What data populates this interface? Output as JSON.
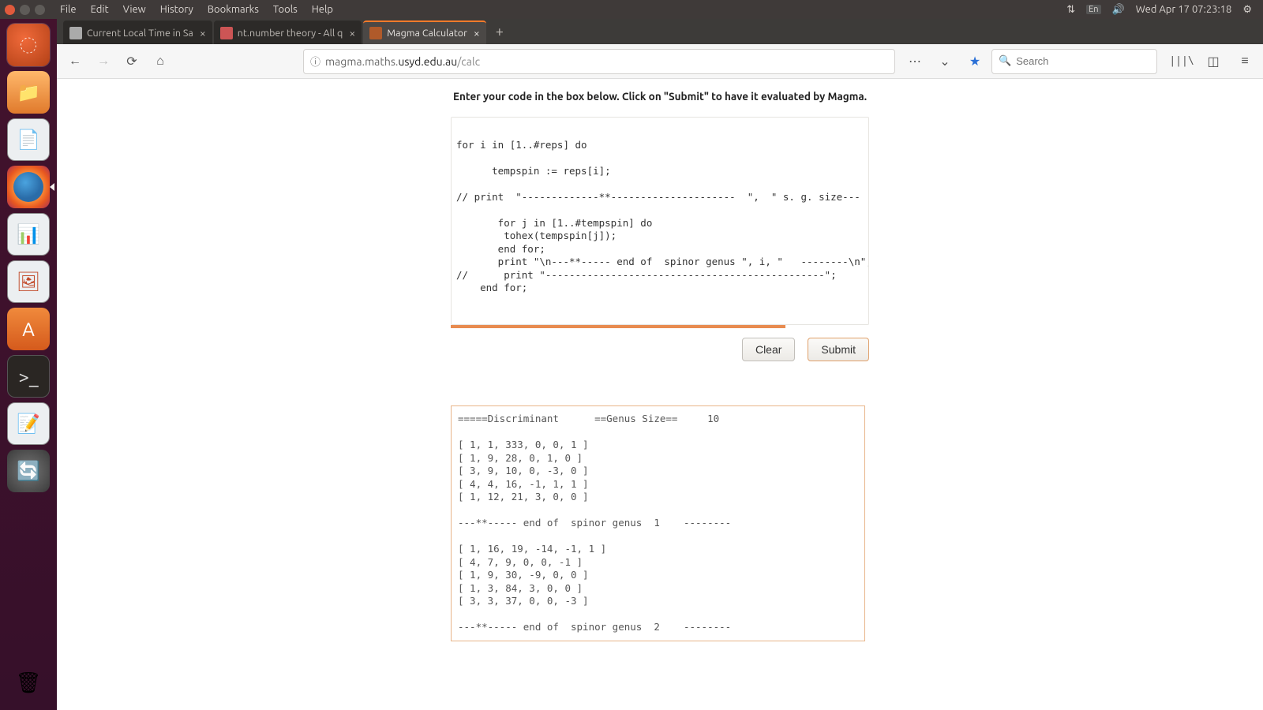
{
  "menubar": {
    "items": [
      "File",
      "Edit",
      "View",
      "History",
      "Bookmarks",
      "Tools",
      "Help"
    ],
    "tray": {
      "lang": "En",
      "datetime": "Wed Apr 17 07:23:18"
    }
  },
  "launcher": {
    "items": [
      {
        "name": "dash",
        "label": "Dash"
      },
      {
        "name": "files",
        "label": "Files"
      },
      {
        "name": "writer",
        "label": "Writer"
      },
      {
        "name": "firefox",
        "label": "Firefox",
        "active": true
      },
      {
        "name": "calc",
        "label": "Calc"
      },
      {
        "name": "impress",
        "label": "Impress"
      },
      {
        "name": "store",
        "label": "Software"
      },
      {
        "name": "terminal",
        "label": "Terminal"
      },
      {
        "name": "textedit",
        "label": "Text Editor"
      },
      {
        "name": "updater",
        "label": "Updater"
      }
    ],
    "trash_label": "Trash"
  },
  "browser": {
    "tabs": [
      {
        "title": "Current Local Time in Sa",
        "active": false
      },
      {
        "title": "nt.number theory - All q",
        "active": false
      },
      {
        "title": "Magma Calculator",
        "active": true
      }
    ],
    "address": {
      "prefix": "magma.maths.",
      "host": "usyd.edu.au",
      "path": "/calc"
    },
    "search_placeholder": "Search"
  },
  "page": {
    "instruction": "Enter your code in the box below. Click on \"Submit\" to have it evaluated by Magma.",
    "code": "\nfor i in [1..#reps] do\n\n      tempspin := reps[i];\n\n// print  \"-------------**---------------------  \",  \" s. g. size---   \",  #tem\n\n       for j in [1..#tempspin] do\n        tohex(tempspin[j]);\n       end for;\n       print \"\\n---**----- end of  spinor genus \", i, \"   --------\\n\";\n//      print \"-----------------------------------------------\";\n    end for;\n",
    "buttons": {
      "clear": "Clear",
      "submit": "Submit"
    },
    "output": "=====Discriminant      ==Genus Size==     10\n\n[ 1, 1, 333, 0, 0, 1 ]\n[ 1, 9, 28, 0, 1, 0 ]\n[ 3, 9, 10, 0, -3, 0 ]\n[ 4, 4, 16, -1, 1, 1 ]\n[ 1, 12, 21, 3, 0, 0 ]\n\n---**----- end of  spinor genus  1    --------\n\n[ 1, 16, 19, -14, -1, 1 ]\n[ 4, 7, 9, 0, 0, -1 ]\n[ 1, 9, 30, -9, 0, 0 ]\n[ 1, 3, 84, 3, 0, 0 ]\n[ 3, 3, 37, 0, 0, -3 ]\n\n---**----- end of  spinor genus  2    --------\n"
  }
}
